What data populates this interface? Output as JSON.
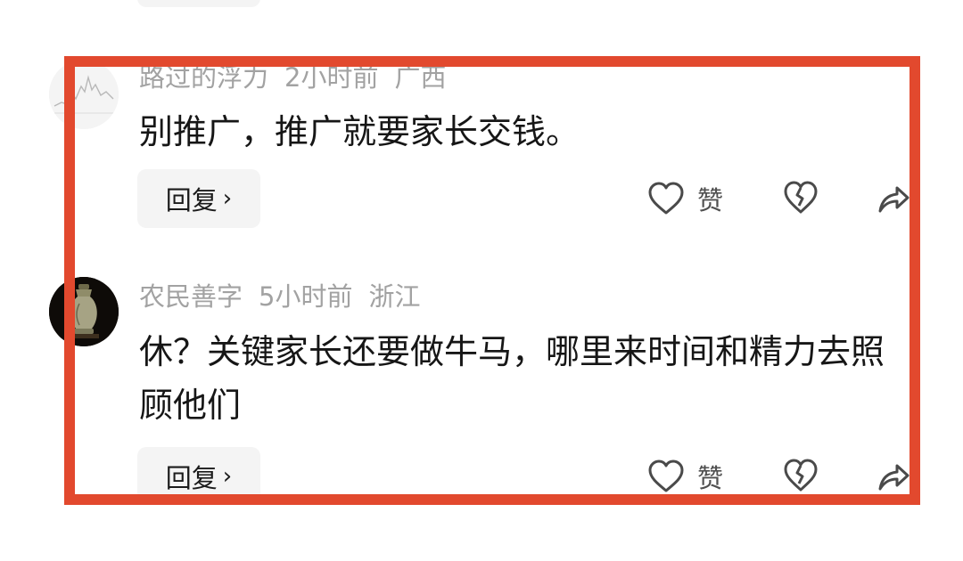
{
  "comments": [
    {
      "username": "路过的浮力",
      "time": "2小时前",
      "location": "广西",
      "text": "别推广，推广就要家长交钱。",
      "reply_label": "回复",
      "like_label": "赞",
      "avatar_icon": "chart-avatar-icon"
    },
    {
      "username": "农民善字",
      "time": "5小时前",
      "location": "浙江",
      "text": "休？关键家长还要做牛马，哪里来时间和精力去照顾他们",
      "reply_label": "回复",
      "like_label": "赞",
      "avatar_icon": "jade-vase-avatar-icon"
    }
  ],
  "icons": {
    "like": "heart-icon",
    "dislike": "broken-heart-icon",
    "share": "share-icon",
    "chevron": "chevron-right-icon"
  },
  "colors": {
    "highlight": "#e2492e",
    "meta_text": "#a2a2a2",
    "body_text": "#161616",
    "pill_bg": "#f4f4f4"
  }
}
